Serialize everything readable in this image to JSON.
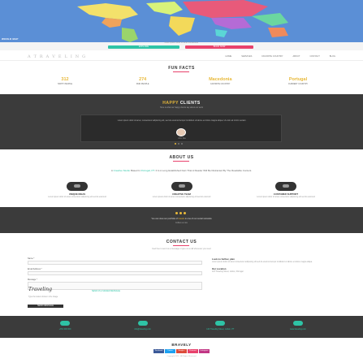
{
  "hero": {
    "label": "WORLD MAP",
    "caption": "Lorem ipsum dolor sit amet consectetur",
    "btn_primary": "EXPLORE",
    "btn_secondary": "BOOK NOW"
  },
  "nav": {
    "logo": "A T R A V E L I N G",
    "items": [
      "HOME",
      "SERVICES",
      "FAVORITE COUNTRY",
      "ABOUT",
      "CONTACT",
      "BLOG"
    ]
  },
  "fun_facts": {
    "title": "FUN FACTS",
    "items": [
      {
        "number": "312",
        "label": "HAPPY PEOPLE"
      },
      {
        "number": "274",
        "label": "PAID PEOPLE"
      },
      {
        "number": "Macedonia",
        "label": "FAVORITE COUNTRY"
      },
      {
        "number": "Portugal",
        "label": "CURRENT COUNTRY"
      }
    ]
  },
  "clients": {
    "title_hl": "HAPPY",
    "title_rest": "CLIENTS",
    "subtitle": "Here is what our happy clients say about our work",
    "quote": "Lorem ipsum dolor sit amet, consectetur adipiscing elit, sed do eiusmod tempor incididunt ut labore et dolore magna aliqua. Ut enim ad minim veniam.",
    "name": "John Doe"
  },
  "about": {
    "title": "ABOUT US",
    "text_pre": "A",
    "text_link1": "Creative Studio",
    "text_mid": "Based In",
    "text_link2": "Portugal, PT",
    "text_post": ". It Is A Long Established Fact That A Reader Will Be Distracted By The Readable Content.",
    "features": [
      {
        "title": "UNIQUE IDEAS",
        "desc": "Lorem ipsum dolor sit amet consectetur adipiscing elit sed do eiusmod"
      },
      {
        "title": "CREATIVE TEAM",
        "desc": "Lorem ipsum dolor sit amet consectetur adipiscing elit sed do eiusmod"
      },
      {
        "title": "CUSTOMER SUPPORT",
        "desc": "Lorem ipsum dolor sit amet consectetur adipiscing elit sed do eiusmod"
      }
    ]
  },
  "band": {
    "text_pre": "You can view our portfolio of",
    "text_hl": "travels",
    "text_post": "in one of our social networks",
    "sub": "Follow us now"
  },
  "contact": {
    "title": "CONTACT US",
    "subtitle": "Feel free to send us a message or give us a call whenever you need",
    "labels": [
      "Name *",
      "Email Address *",
      "Message *"
    ],
    "signature": "Traveling",
    "sig_link": "SEND US A SIGNED MESSAGE",
    "captcha_note": "Type the letters shown in the image",
    "send_label": "SEND MESSAGE",
    "info_title": "Look no further, plan",
    "info_text": "Lorem ipsum dolor sit amet consectetur adipiscing elit sed do eiusmod tempor incididunt ut labore et dolore magna aliqua.",
    "info_title2": "Our Location",
    "info_text2": "123 Traveling Street, Lisbon, Portugal"
  },
  "strip": {
    "items": [
      "+351 000 000",
      "info@traveling.com",
      "123 Traveling Street, Lisbon, PT",
      "www.traveling.com"
    ]
  },
  "footer": {
    "logo": "BRAVELY",
    "social": [
      "Facebook",
      "Twitter",
      "Google+",
      "Pinterest",
      "Instagram"
    ],
    "copy": "Copyright 2016 - All Rights Reserved"
  },
  "colors": {
    "accent_yellow": "#e8b93a",
    "accent_teal": "#2ec4a6",
    "accent_pink": "#e8426c",
    "dark_band": "#3b3b3b"
  }
}
